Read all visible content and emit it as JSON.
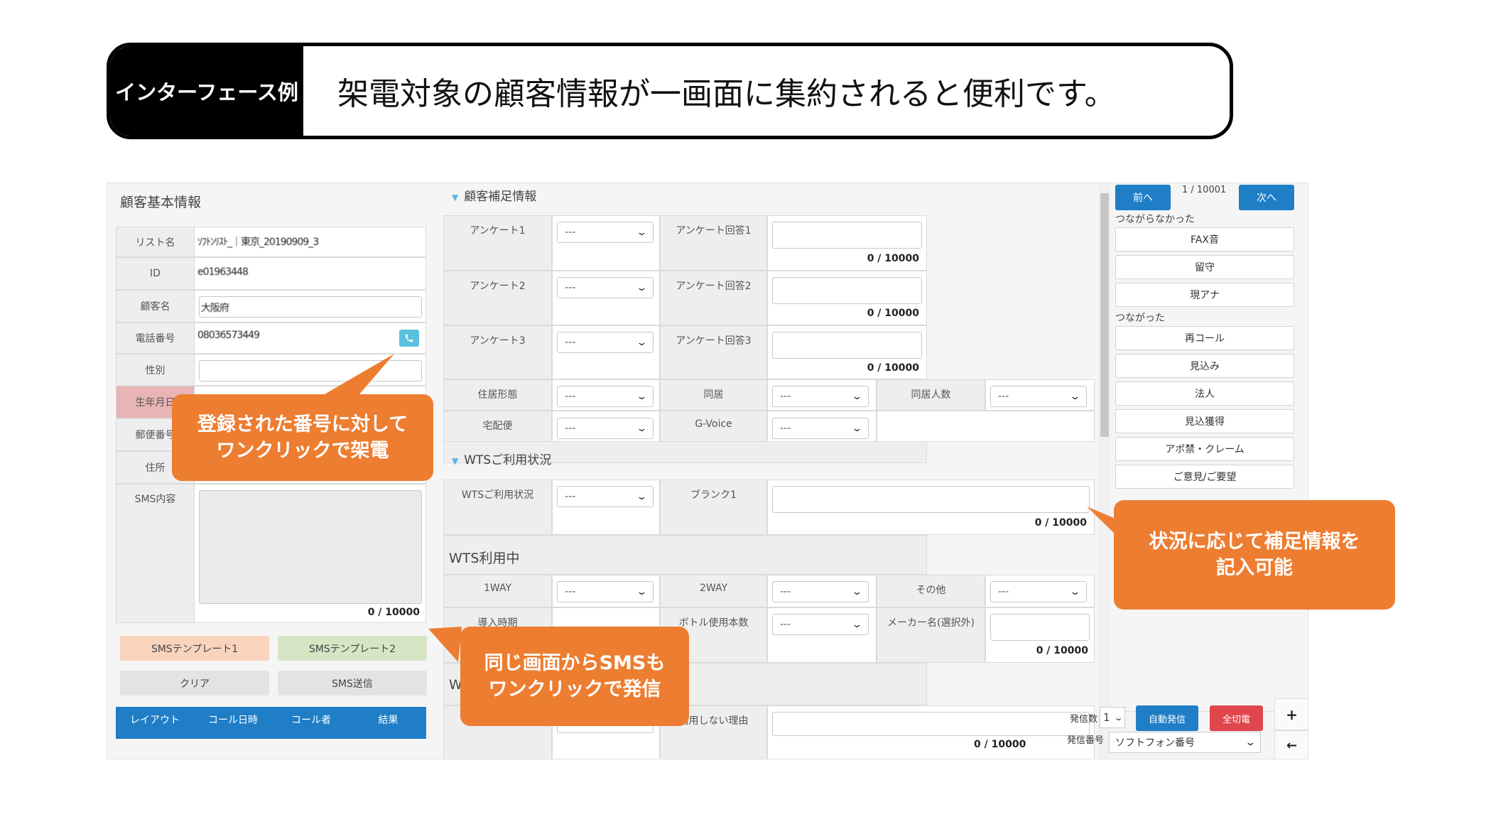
{
  "banner": {
    "tag": "インターフェース例",
    "text": "架電対象の顧客情報が一画面に集約されると便利です。"
  },
  "left": {
    "title": "顧客基本情報",
    "fields": {
      "list_name": "リスト名",
      "id": "ID",
      "customer_name": "顧客名",
      "phone": "電話番号",
      "gender": "性別",
      "birthday": "生年月日",
      "postal": "郵便番号",
      "address": "住所",
      "sms": "SMS内容"
    },
    "values": {
      "list_name": "ｿﾌﾄﾝﾘｽﾄ_｜東京_20190909_3",
      "id": "e01963448",
      "customer_name": "大阪府",
      "phone": "08036573449"
    },
    "sms_count": "0 / 10000",
    "sms_template1": "SMSテンプレート1",
    "sms_template2": "SMSテンプレート2",
    "clear": "クリア",
    "sms_send": "SMS送信",
    "history_cols": [
      "レイアウト",
      "コール日時",
      "コール者",
      "結果"
    ]
  },
  "mid": {
    "section1": "顧客補足情報",
    "q1": "アンケート1",
    "q2": "アンケート2",
    "q3": "アンケート3",
    "a1": "アンケート回答1",
    "a2": "アンケート回答2",
    "a3": "アンケート回答3",
    "housing": "住居形態",
    "cohabit": "同居",
    "cohabit_count": "同居人数",
    "delivery": "宅配便",
    "gvoice": "G-Voice",
    "section2": "WTSご利用状況",
    "wts_status": "WTSご利用状況",
    "blank1": "ブランク1",
    "wts_using": "WTS利用中",
    "way1": "1WAY",
    "way2": "2WAY",
    "other": "その他",
    "intro_period": "導入時期",
    "bottles": "ボトル使用本数",
    "maker": "メーカー名(選択外)",
    "reason": "利用しない理由",
    "w_partial": "W",
    "select_default": "---",
    "count": "0 / 10000",
    "count_partial": "0 / 10000"
  },
  "right": {
    "prev": "前へ",
    "page": "1 / 10001",
    "next": "次へ",
    "group1": "つながらなかった",
    "g1_buttons": [
      "FAX音",
      "留守",
      "現アナ"
    ],
    "group2": "つながった",
    "g2_buttons": [
      "再コール",
      "見込み",
      "法人",
      "見込獲得",
      "アポ禁・クレーム",
      "ご意見/ご要望"
    ],
    "dial_count_label": "発信数",
    "dial_count_value": "1",
    "auto_dial": "自動発信",
    "hangup_all": "全切電",
    "caller_number_label": "発信番号",
    "caller_number_value": "ソフトフォン番号",
    "plus": "+",
    "back": "←"
  },
  "callouts": {
    "c1": [
      "登録された番号に対して",
      "ワンクリックで架電"
    ],
    "c2": [
      "同じ画面からSMSも",
      "ワンクリックで発信"
    ],
    "c3": [
      "状況に応じて補足情報を",
      "記入可能"
    ]
  },
  "colors": {
    "accent": "#1f7ec6",
    "callout": "#ed7d31",
    "red": "#e0474c"
  }
}
